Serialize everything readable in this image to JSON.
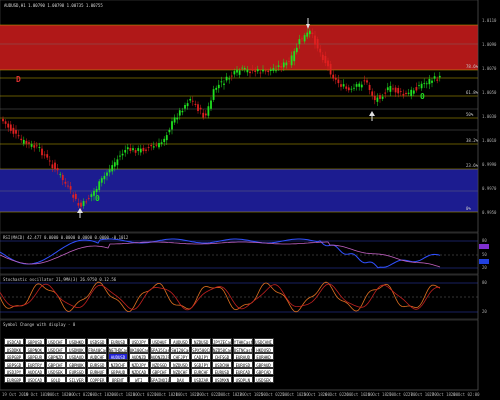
{
  "window": {
    "title": "AUDUSD,H1  1.00790 1.00798 1.00735 1.00755"
  },
  "price_panel": {
    "fib_labels": [
      "78.6%",
      "61.8%",
      "50%",
      "38.2%",
      "23.6%",
      "0%"
    ],
    "price_labels": [
      "1.0110",
      "1.0090",
      "1.0070",
      "1.0050",
      "1.0030",
      "1.0010",
      "0.9990",
      "0.9970",
      "0.9950"
    ],
    "markers": {
      "d_label": "D",
      "zero1": "0",
      "zero2": "0"
    },
    "colors": {
      "resistance_zone": "#b01818",
      "support_zone": "#1c1c90",
      "bull": "#20e020",
      "bear": "#e02020",
      "level_line": "#c8b000"
    }
  },
  "indicator1": {
    "title": "RSI(MACD) 42.477 0.0000 0.0000 0.0000 0.0000 -0.1012",
    "right_labels": [
      "80",
      "50",
      "20"
    ]
  },
  "indicator2": {
    "title": "Stochastic oscillator 21,9MA(3) 26.9750 0.12.56",
    "right_labels": [
      "80",
      "20"
    ]
  },
  "currency_panel": {
    "title": "Symbol Change with display - 0",
    "symbols": [
      [
        "USDCAD",
        "GBPUSD",
        "USDCHF",
        "USDHKD",
        "USDSGD",
        "EURUSD",
        "USDJPY",
        "USDHUF",
        "AUDUSD",
        "NZDUSD",
        "JPYZECash",
        "YTHKCash",
        "USDCANI"
      ],
      [
        "USDDKK",
        "GBPNOK",
        "USDCHF",
        "USDNOK",
        "FRA40Cash",
        "NETHDCash",
        "UK100Cash",
        "SPA35Cash",
        "SWI20Cash",
        "SPX500Cash",
        "NZD50Cash",
        "USTNCash",
        "HKDUSD"
      ],
      [
        "GBPGBP",
        "GBPEUR",
        "GBPNZD",
        "USDAUD",
        "AUDCHF",
        "AUDUSD",
        "AUDNZD",
        "AUDNZDJPY",
        "CHFJPY",
        "CADJPY",
        "CHFSGD",
        "EURAUD",
        "EURHKD"
      ],
      [
        "GBPSGD",
        "EURTRY",
        "GBPCHF",
        "GBPNOK",
        "EURSGD",
        "NZDCHF",
        "NZDJPY",
        "NZDSGD",
        "NZDUSD",
        "SGDJPY",
        "USDCNH",
        "EURUSD",
        "GBPAUD"
      ],
      [
        "USDJPY",
        "AUDCAD",
        "USDSEK",
        "EURSGD",
        "EURHUF",
        "GBPAUD",
        "NZDCAD",
        "GBPCHF",
        "NZDCHF",
        "EURCHF",
        "EURUSD",
        "EURCAD",
        "GBPCAD"
      ],
      [
        "EURGBP",
        "USDCAD",
        "GOLD",
        "SILVER",
        "COPPER",
        "BRENT",
        "WTI",
        "SPAINOIL",
        "DAX",
        "USDZAR",
        "USDMXN",
        "USDPLN",
        "USDSEK"
      ]
    ],
    "selected": "AUDUSD"
  },
  "time_axis": [
    "19 Oct 2010",
    "19 Oct 10:00",
    "19 Oct 18:00",
    "20 Oct 02:00",
    "20 Oct 10:00",
    "20 Oct 18:00",
    "21 Oct 02:00",
    "21 Oct 10:00",
    "21 Oct 18:00",
    "22 Oct 02:00",
    "22 Oct 10:00",
    "22 Oct 18:00",
    "25 Oct 02:00",
    "25 Oct 10:00",
    "25 Oct 18:00",
    "26 Oct 02:00",
    "26 Oct 10:00",
    "26 Oct 18:00",
    "27 Oct 02:00",
    "27 Oct 10:00",
    "27 Oct 18:00",
    "28 Oct 02:00"
  ]
}
